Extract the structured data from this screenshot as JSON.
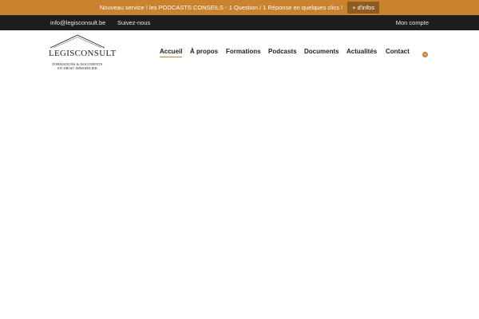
{
  "announcement": {
    "text": "Nouveau service ! les PODCASTS CONSEILS - 1 Question / 1 Réponse en quelques clics !",
    "button": "+ d'infos"
  },
  "topbar": {
    "email": "info@legisconsult.be",
    "follow": "Suivez-nous",
    "account": "Mon compte"
  },
  "logo": {
    "name": "LEGISCONSULT",
    "tagline_1": "FORMATIONS & DOCUMENTS",
    "tagline_2": "EN DROIT IMMOBILIER"
  },
  "nav": {
    "items": [
      {
        "label": "Accueil",
        "active": true
      },
      {
        "label": "À propos"
      },
      {
        "label": "Formations"
      },
      {
        "label": "Podcasts"
      },
      {
        "label": "Documents"
      },
      {
        "label": "Actualités"
      },
      {
        "label": "Contact"
      }
    ]
  },
  "cart": {
    "count": "0"
  },
  "colors": {
    "accent": "#c9822e",
    "topbar": "#1e1e1e",
    "button": "#8f5b20"
  }
}
